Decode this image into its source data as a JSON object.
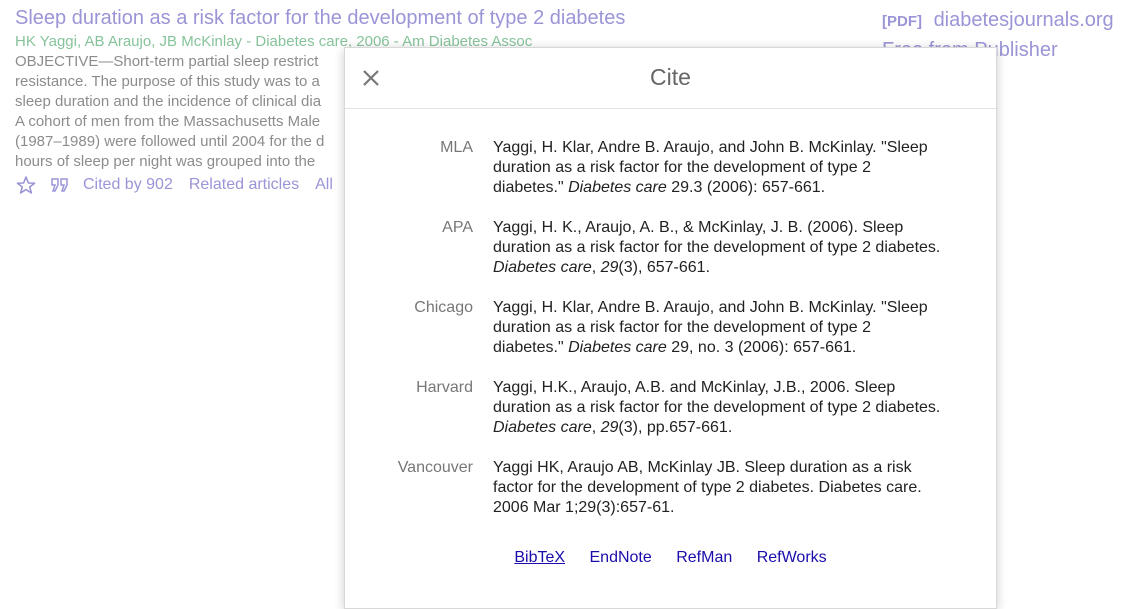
{
  "result": {
    "title": "Sleep duration as a risk factor for the development of type 2 diabetes",
    "authors": "HK Yaggi, AB Araujo, JB McKinlay - Diabetes care, 2006 - Am Diabetes Assoc",
    "snippet_lines": [
      "OBJECTIVE—Short-term partial sleep restrict",
      "resistance. The purpose of this study was to a",
      "sleep duration and the incidence of clinical dia",
      "A cohort of men from the Massachusetts Male",
      "(1987–1989) were followed until 2004 for the d",
      "hours of sleep per night was grouped into the"
    ],
    "cited_by": "Cited by 902",
    "related": "Related articles",
    "all_versions": "All",
    "side_tag": "[PDF]",
    "side_domain": "diabetesjournals.org",
    "side_free": "Free from Publisher"
  },
  "modal": {
    "title": "Cite",
    "citations": [
      {
        "style": "MLA",
        "text_before": "Yaggi, H. Klar, Andre B. Araujo, and John B. McKinlay. \"Sleep duration as a risk factor for the development of type 2 diabetes.\" ",
        "journal": "Diabetes care",
        "text_after": " 29.3 (2006): 657-661."
      },
      {
        "style": "APA",
        "text_before": "Yaggi, H. K., Araujo, A. B., & McKinlay, J. B. (2006). Sleep duration as a risk factor for the development of type 2 diabetes. ",
        "journal": "Diabetes care",
        "text_mid": ", ",
        "volume": "29",
        "text_after": "(3), 657-661."
      },
      {
        "style": "Chicago",
        "text_before": "Yaggi, H. Klar, Andre B. Araujo, and John B. McKinlay. \"Sleep duration as a risk factor for the development of type 2 diabetes.\" ",
        "journal": "Diabetes care",
        "text_after": " 29, no. 3 (2006): 657-661."
      },
      {
        "style": "Harvard",
        "text_before": "Yaggi, H.K., Araujo, A.B. and McKinlay, J.B., 2006. Sleep duration as a risk factor for the development of type 2 diabetes. ",
        "journal": "Diabetes care",
        "text_mid": ", ",
        "volume": "29",
        "text_after": "(3), pp.657-661."
      },
      {
        "style": "Vancouver",
        "text_before": "Yaggi HK, Araujo AB, McKinlay JB. Sleep duration as a risk factor for the development of type 2 diabetes. Diabetes care. 2006 Mar 1;29(3):657-61.",
        "journal": "",
        "text_after": ""
      }
    ],
    "exports": [
      "BibTeX",
      "EndNote",
      "RefMan",
      "RefWorks"
    ]
  }
}
